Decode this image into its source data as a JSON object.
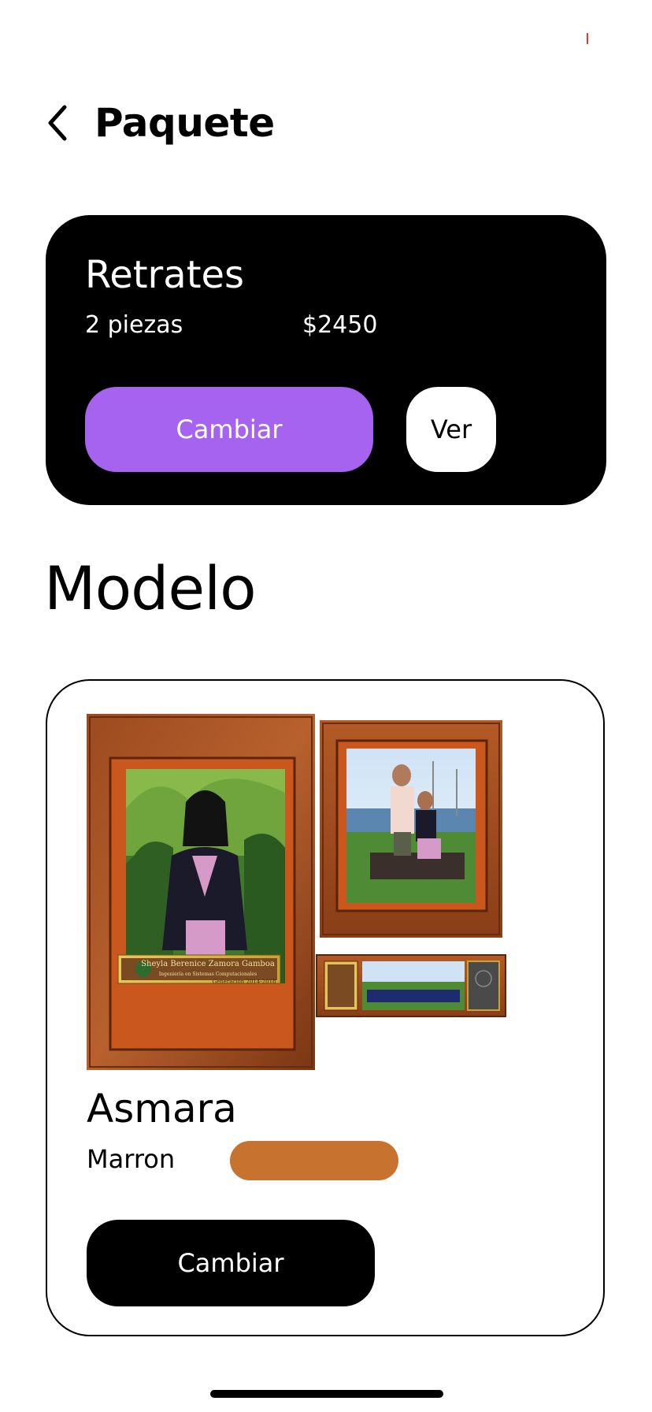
{
  "header": {
    "title": "Paquete",
    "back_icon": "chevron-left-icon"
  },
  "package": {
    "name": "Retrates",
    "pieces": "2 piezas",
    "price": "$2450",
    "change_label": "Cambiar",
    "view_label": "Ver",
    "accent_color": "#a563ef"
  },
  "model_section": {
    "title": "Modelo"
  },
  "model": {
    "name": "Asmara",
    "color_label": "Marron",
    "color_value": "#c87230",
    "change_label": "Cambiar",
    "image_caption": "Sheyla Berenice Zamora Gamboa",
    "image_subcaption": "Ingeniería en Sistemas Computacionales",
    "image_generation": "Generación 2014-2018"
  }
}
